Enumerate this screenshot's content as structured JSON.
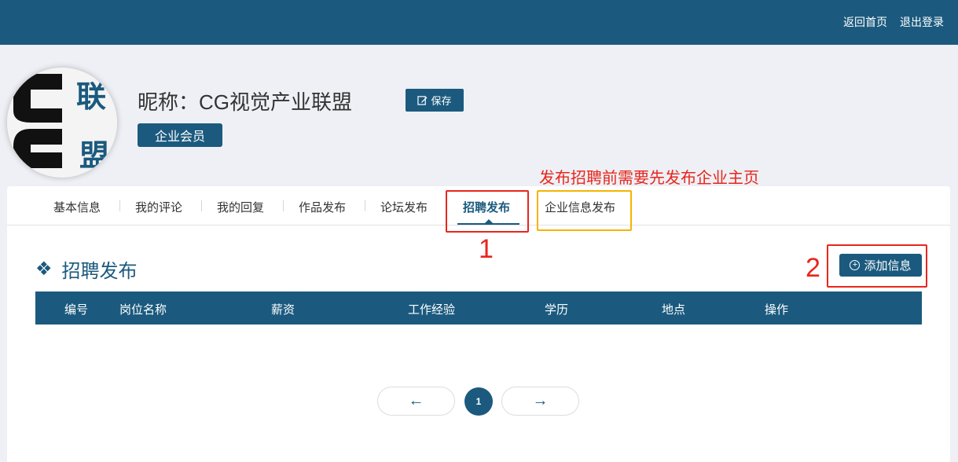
{
  "topbar": {
    "home_link": "返回首页",
    "logout_link": "退出登录"
  },
  "profile": {
    "avatar_chars": [
      "联",
      "盟"
    ],
    "nickname": "昵称：CG视觉产业联盟",
    "save_label": "保存",
    "member_badge": "企业会员"
  },
  "annotations": {
    "note": "发布招聘前需要先发布企业主页",
    "marker1": "1",
    "marker2": "2"
  },
  "tabs": [
    {
      "label": "基本信息"
    },
    {
      "label": "我的评论"
    },
    {
      "label": "我的回复"
    },
    {
      "label": "作品发布"
    },
    {
      "label": "论坛发布"
    },
    {
      "label": "招聘发布",
      "active": true
    },
    {
      "label": "企业信息发布"
    }
  ],
  "section": {
    "title": "招聘发布",
    "add_label": "添加信息"
  },
  "table": {
    "columns": [
      "编号",
      "岗位名称",
      "薪资",
      "工作经验",
      "学历",
      "地点",
      "操作"
    ],
    "rows": []
  },
  "pagination": {
    "prev": "←",
    "current": "1",
    "next": "→"
  },
  "colors": {
    "primary": "#1b5a7e",
    "annotation_red": "#e8261c",
    "annotation_yellow": "#f5b400",
    "background": "#eef0f5"
  }
}
